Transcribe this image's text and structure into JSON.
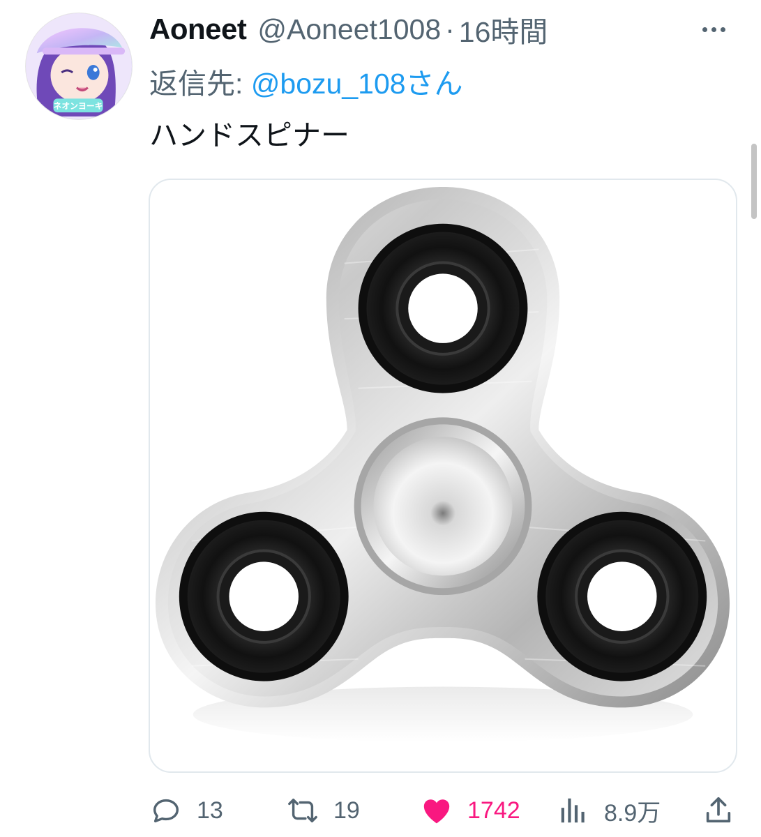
{
  "tweet": {
    "display_name": "Aoneet",
    "handle": "@Aoneet1008",
    "separator": "·",
    "time": "16時間",
    "reply_label": "返信先:",
    "reply_to": "@bozu_108さん",
    "text": "ハンドスピナー",
    "avatar_badge_text": "ネオンヨーキ"
  },
  "actions": {
    "reply": {
      "icon": "reply-icon",
      "count": "13"
    },
    "retweet": {
      "icon": "retweet-icon",
      "count": "19"
    },
    "like": {
      "icon": "heart-icon",
      "count": "1742",
      "liked": true
    },
    "views": {
      "icon": "analytics-icon",
      "count": "8.9万"
    },
    "share": {
      "icon": "share-icon"
    }
  },
  "colors": {
    "text_primary": "#0f1419",
    "text_secondary": "#536471",
    "link": "#1d9bf0",
    "like": "#f91880",
    "media_border": "#e1e8ed"
  }
}
